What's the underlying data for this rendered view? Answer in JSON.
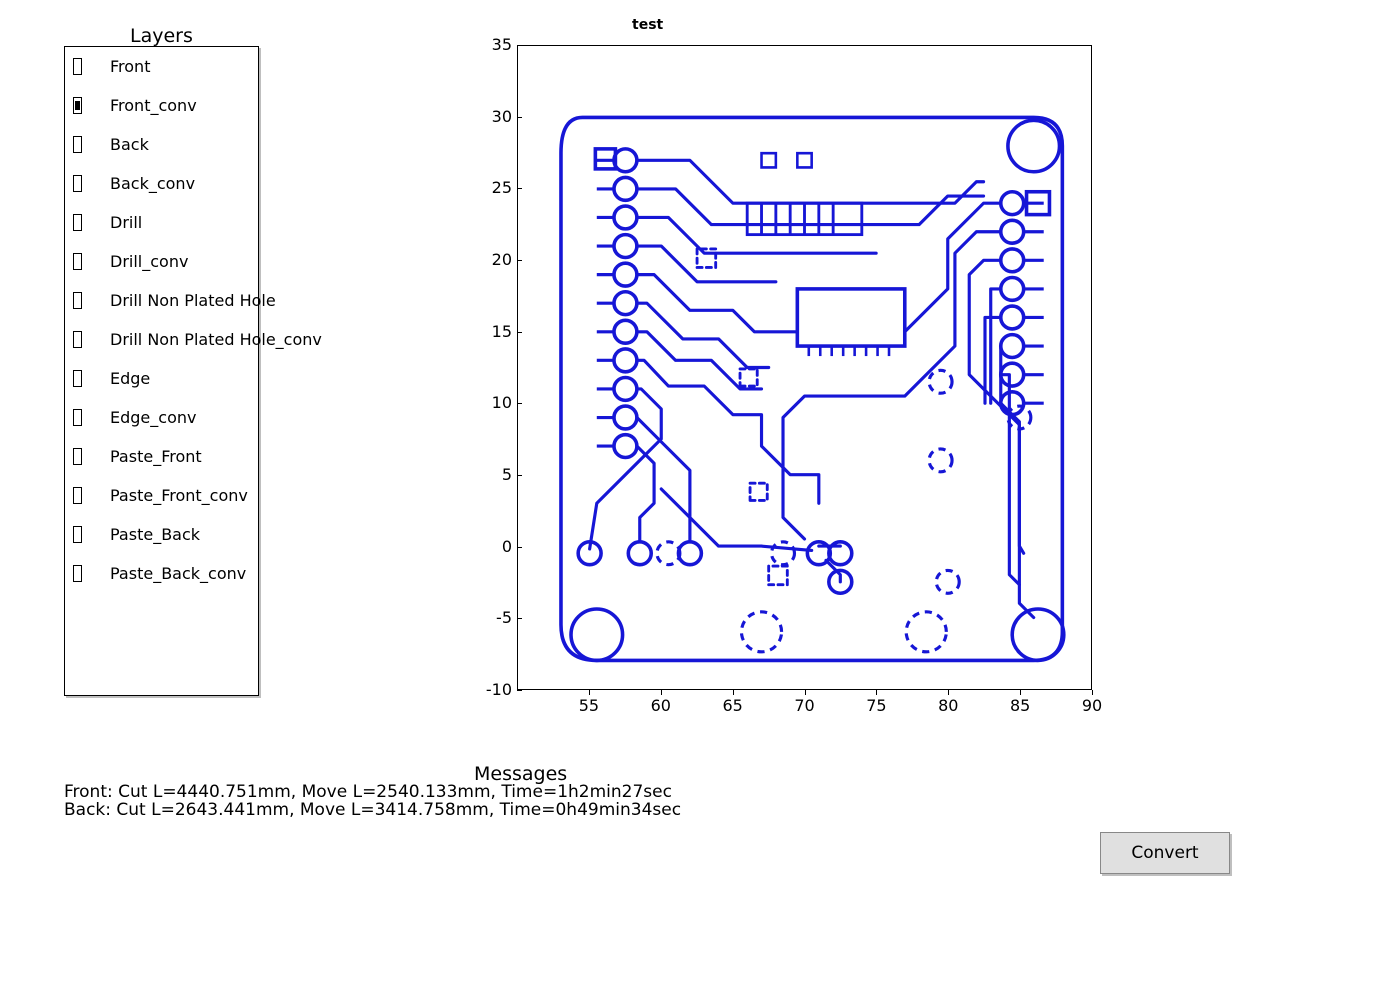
{
  "layers": {
    "title": "Layers",
    "items": [
      {
        "label": "Front",
        "checked": false
      },
      {
        "label": "Front_conv",
        "checked": true
      },
      {
        "label": "Back",
        "checked": false
      },
      {
        "label": "Back_conv",
        "checked": false
      },
      {
        "label": "Drill",
        "checked": false
      },
      {
        "label": "Drill_conv",
        "checked": false
      },
      {
        "label": "Drill Non Plated Hole",
        "checked": false
      },
      {
        "label": "Drill Non Plated Hole_conv",
        "checked": false
      },
      {
        "label": "Edge",
        "checked": false
      },
      {
        "label": "Edge_conv",
        "checked": false
      },
      {
        "label": "Paste_Front",
        "checked": false
      },
      {
        "label": "Paste_Front_conv",
        "checked": false
      },
      {
        "label": "Paste_Back",
        "checked": false
      },
      {
        "label": "Paste_Back_conv",
        "checked": false
      }
    ]
  },
  "chart_data": {
    "type": "pcb_layout",
    "title": "test",
    "xlabel": "",
    "ylabel": "",
    "xlim": [
      50,
      90
    ],
    "ylim": [
      -10,
      35
    ],
    "xticks": [
      55,
      60,
      65,
      70,
      75,
      80,
      85,
      90
    ],
    "yticks": [
      -10,
      -5,
      0,
      5,
      10,
      15,
      20,
      25,
      30,
      35
    ],
    "board_outline": {
      "xmin": 53,
      "xmax": 88,
      "ymin": -8,
      "ymax": 30
    },
    "corner_holes_radius_large": 1.8,
    "corner_holes": [
      {
        "x": 55.5,
        "y": -6.5
      },
      {
        "x": 86.5,
        "y": -6.5
      },
      {
        "x": 86.0,
        "y": 28.0
      }
    ],
    "left_pads": [
      {
        "x": 57.5,
        "y": 27
      },
      {
        "x": 57.5,
        "y": 25
      },
      {
        "x": 57.5,
        "y": 23
      },
      {
        "x": 57.5,
        "y": 21
      },
      {
        "x": 57.5,
        "y": 19
      },
      {
        "x": 57.5,
        "y": 17
      },
      {
        "x": 57.5,
        "y": 15
      },
      {
        "x": 57.5,
        "y": 13
      },
      {
        "x": 57.5,
        "y": 11
      },
      {
        "x": 57.5,
        "y": 9
      },
      {
        "x": 57.5,
        "y": 7
      }
    ],
    "right_pads": [
      {
        "x": 84.5,
        "y": 24
      },
      {
        "x": 84.5,
        "y": 22
      },
      {
        "x": 84.5,
        "y": 20
      },
      {
        "x": 84.5,
        "y": 18
      },
      {
        "x": 84.5,
        "y": 16
      },
      {
        "x": 84.5,
        "y": 14
      },
      {
        "x": 84.5,
        "y": 12
      },
      {
        "x": 84.5,
        "y": 10
      }
    ],
    "routed_from": "left_and_right_pads_to_center_components",
    "dashed_vias": [
      {
        "x": 60.5,
        "y": -0.5,
        "r": 0.7
      },
      {
        "x": 68.5,
        "y": -0.5,
        "r": 0.7
      },
      {
        "x": 79.5,
        "y": 6,
        "r": 0.7
      },
      {
        "x": 79.5,
        "y": 11.5,
        "r": 0.7
      },
      {
        "x": 85,
        "y": 9,
        "r": 0.7
      },
      {
        "x": 80,
        "y": -2.5,
        "r": 0.7
      }
    ],
    "dashed_large": [
      {
        "x": 67,
        "y": -6,
        "r": 1.5
      },
      {
        "x": 78.5,
        "y": -6,
        "r": 1.5
      }
    ],
    "bottom_pads": [
      {
        "x": 55,
        "y": -0.5
      },
      {
        "x": 58.5,
        "y": -0.5
      },
      {
        "x": 62,
        "y": -0.5
      },
      {
        "x": 71,
        "y": -0.5
      },
      {
        "x": 72.5,
        "y": -0.5
      },
      {
        "x": 72.5,
        "y": -2.5
      }
    ],
    "square_pad": {
      "x": 56,
      "y": 27,
      "side": 1.2
    },
    "trace_color": "#1616d6"
  },
  "messages": {
    "title": "Messages",
    "lines": [
      "Front: Cut L=4440.751mm, Move L=2540.133mm, Time=1h2min27sec",
      "Back: Cut L=2643.441mm, Move L=3414.758mm, Time=0h49min34sec"
    ]
  },
  "convert_button": "Convert"
}
